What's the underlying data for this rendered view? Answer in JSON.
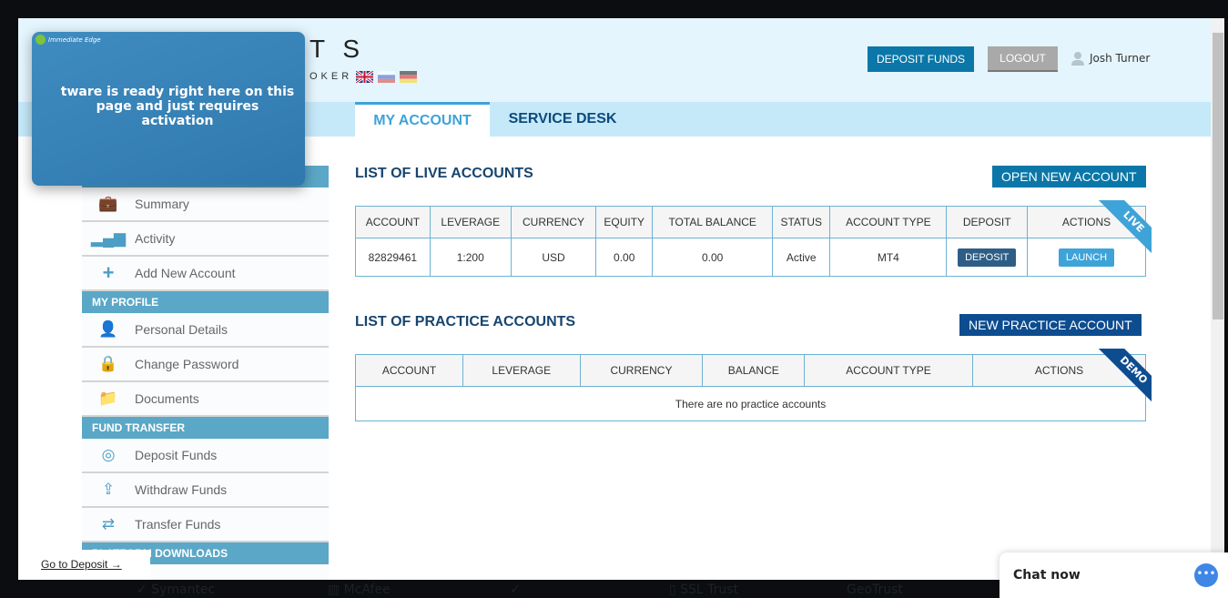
{
  "header": {
    "logo_text": "T S",
    "logo_sub": "OKER",
    "deposit_funds": "DEPOSIT FUNDS",
    "logout": "LOGOUT",
    "user_name": "Josh Turner",
    "flags": [
      "uk",
      "ru",
      "de"
    ]
  },
  "tabs": [
    {
      "label": "MY ACCOUNT",
      "active": true
    },
    {
      "label": "SERVICE DESK",
      "active": false
    }
  ],
  "sidebar": {
    "items_top": [
      {
        "label": "Summary",
        "icon": "briefcase-icon"
      },
      {
        "label": "Activity",
        "icon": "bar-chart-icon"
      },
      {
        "label": "Add New Account",
        "icon": "plus-icon"
      }
    ],
    "profile_head": "MY PROFILE",
    "profile": [
      {
        "label": "Personal Details",
        "icon": "user-icon"
      },
      {
        "label": "Change Password",
        "icon": "lock-icon"
      },
      {
        "label": "Documents",
        "icon": "folder-icon"
      }
    ],
    "fund_head": "FUND TRANSFER",
    "fund": [
      {
        "label": "Deposit Funds",
        "icon": "coins-icon"
      },
      {
        "label": "Withdraw Funds",
        "icon": "upload-icon"
      },
      {
        "label": "Transfer Funds",
        "icon": "transfer-icon"
      }
    ],
    "platform_head": "PLATFORM DOWNLOADS"
  },
  "live": {
    "title": "LIST OF LIVE ACCOUNTS",
    "button": "OPEN NEW ACCOUNT",
    "ribbon": "LIVE",
    "columns": [
      "ACCOUNT",
      "LEVERAGE",
      "CURRENCY",
      "EQUITY",
      "TOTAL BALANCE",
      "STATUS",
      "ACCOUNT TYPE",
      "DEPOSIT",
      "ACTIONS"
    ],
    "rows": [
      {
        "account": "82829461",
        "leverage": "1:200",
        "currency": "USD",
        "equity": "0.00",
        "total_balance": "0.00",
        "status": "Active",
        "account_type": "MT4",
        "deposit": "DEPOSIT",
        "action": "LAUNCH"
      }
    ]
  },
  "practice": {
    "title": "LIST OF PRACTICE ACCOUNTS",
    "button": "NEW PRACTICE ACCOUNT",
    "ribbon": "DEMO",
    "columns": [
      "ACCOUNT",
      "LEVERAGE",
      "CURRENCY",
      "BALANCE",
      "ACCOUNT TYPE",
      "ACTIONS"
    ],
    "empty": "There are no practice accounts"
  },
  "popup": {
    "brand": "Immediate Edge",
    "text": "tware is ready right here on this page and just requires activation"
  },
  "goto_deposit": "Go to Deposit →",
  "chat": {
    "label": "Chat now"
  },
  "colors": {
    "primary": "#0a77a8",
    "navy": "#17456f",
    "sidebar_head": "#5ba7c7",
    "accent": "#3ea3d8",
    "practice": "#0d4c8f"
  }
}
